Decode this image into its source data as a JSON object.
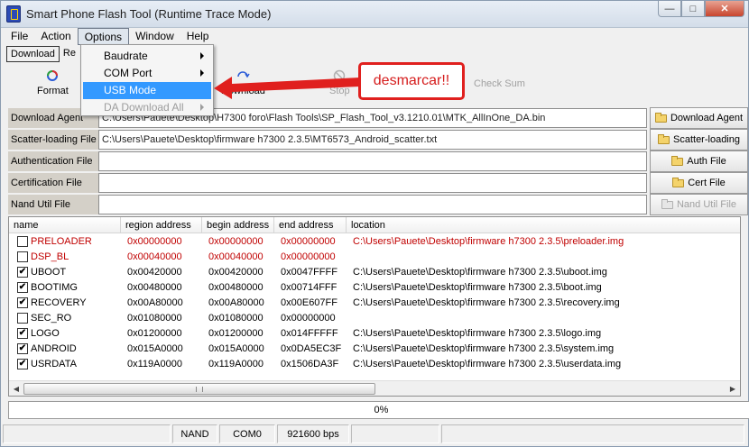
{
  "window": {
    "title": "Smart Phone Flash Tool (Runtime Trace Mode)"
  },
  "menubar": [
    "File",
    "Action",
    "Options",
    "Window",
    "Help"
  ],
  "tabs": {
    "active": "Download",
    "other": "Re"
  },
  "toolbar": {
    "format": "Format",
    "download": "Download",
    "stop": "Stop",
    "checksum": "Check Sum"
  },
  "options_menu": [
    {
      "label": "Baudrate",
      "submenu": true
    },
    {
      "label": "COM Port",
      "submenu": true
    },
    {
      "label": "USB Mode",
      "submenu": false,
      "highlighted": true
    },
    {
      "label": "DA Download All",
      "submenu": true,
      "disabled": true
    }
  ],
  "fields": [
    {
      "label": "Download Agent",
      "value": "C:\\Users\\Pauete\\Desktop\\H7300 foro\\Flash Tools\\SP_Flash_Tool_v3.1210.01\\MTK_AllInOne_DA.bin",
      "button": "Download Agent"
    },
    {
      "label": "Scatter-loading File",
      "value": "C:\\Users\\Pauete\\Desktop\\firmware h7300 2.3.5\\MT6573_Android_scatter.txt",
      "button": "Scatter-loading"
    },
    {
      "label": "Authentication File",
      "value": "",
      "button": "Auth File"
    },
    {
      "label": "Certification File",
      "value": "",
      "button": "Cert File"
    },
    {
      "label": "Nand Util File",
      "value": "",
      "button": "Nand Util File"
    }
  ],
  "table": {
    "columns": [
      "name",
      "region address",
      "begin address",
      "end address",
      "location"
    ],
    "rows": [
      {
        "checked": false,
        "red": true,
        "name": "PRELOADER",
        "region": "0x00000000",
        "begin": "0x00000000",
        "end": "0x00000000",
        "location": "C:\\Users\\Pauete\\Desktop\\firmware h7300 2.3.5\\preloader.img"
      },
      {
        "checked": false,
        "red": true,
        "name": "DSP_BL",
        "region": "0x00040000",
        "begin": "0x00040000",
        "end": "0x00000000",
        "location": ""
      },
      {
        "checked": true,
        "red": false,
        "name": "UBOOT",
        "region": "0x00420000",
        "begin": "0x00420000",
        "end": "0x0047FFFF",
        "location": "C:\\Users\\Pauete\\Desktop\\firmware h7300 2.3.5\\uboot.img"
      },
      {
        "checked": true,
        "red": false,
        "name": "BOOTIMG",
        "region": "0x00480000",
        "begin": "0x00480000",
        "end": "0x00714FFF",
        "location": "C:\\Users\\Pauete\\Desktop\\firmware h7300 2.3.5\\boot.img"
      },
      {
        "checked": true,
        "red": false,
        "name": "RECOVERY",
        "region": "0x00A80000",
        "begin": "0x00A80000",
        "end": "0x00E607FF",
        "location": "C:\\Users\\Pauete\\Desktop\\firmware h7300 2.3.5\\recovery.img"
      },
      {
        "checked": false,
        "red": false,
        "name": "SEC_RO",
        "region": "0x01080000",
        "begin": "0x01080000",
        "end": "0x00000000",
        "location": ""
      },
      {
        "checked": true,
        "red": false,
        "name": "LOGO",
        "region": "0x01200000",
        "begin": "0x01200000",
        "end": "0x014FFFFF",
        "location": "C:\\Users\\Pauete\\Desktop\\firmware h7300 2.3.5\\logo.img"
      },
      {
        "checked": true,
        "red": false,
        "name": "ANDROID",
        "region": "0x015A0000",
        "begin": "0x015A0000",
        "end": "0x0DA5EC3F",
        "location": "C:\\Users\\Pauete\\Desktop\\firmware h7300 2.3.5\\system.img"
      },
      {
        "checked": true,
        "red": false,
        "name": "USRDATA",
        "region": "0x119A0000",
        "begin": "0x119A0000",
        "end": "0x1506DA3F",
        "location": "C:\\Users\\Pauete\\Desktop\\firmware h7300 2.3.5\\userdata.img"
      }
    ]
  },
  "progress": {
    "text": "0%",
    "percent": 0
  },
  "statusbar": {
    "storage": "NAND",
    "port": "COM0",
    "baud": "921600 bps"
  },
  "annotation": {
    "text": "desmarcar!!"
  },
  "colors": {
    "highlight": "#3399ff",
    "annotation": "#e0201e",
    "disabled_row": "#c00000"
  }
}
